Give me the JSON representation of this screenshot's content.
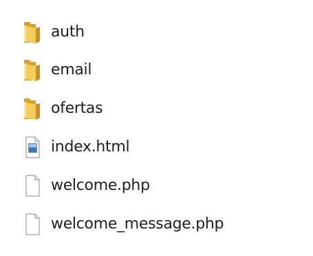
{
  "files": [
    {
      "name": "auth",
      "type": "folder"
    },
    {
      "name": "email",
      "type": "folder"
    },
    {
      "name": "ofertas",
      "type": "folder"
    },
    {
      "name": "index.html",
      "type": "html-document"
    },
    {
      "name": "welcome.php",
      "type": "document"
    },
    {
      "name": "welcome_message.php",
      "type": "document"
    }
  ],
  "colors": {
    "folder_front": "#f2cd5c",
    "folder_back": "#d9a12e",
    "document_border": "#8a8a8a",
    "html_accent": "#5a8fc4"
  }
}
